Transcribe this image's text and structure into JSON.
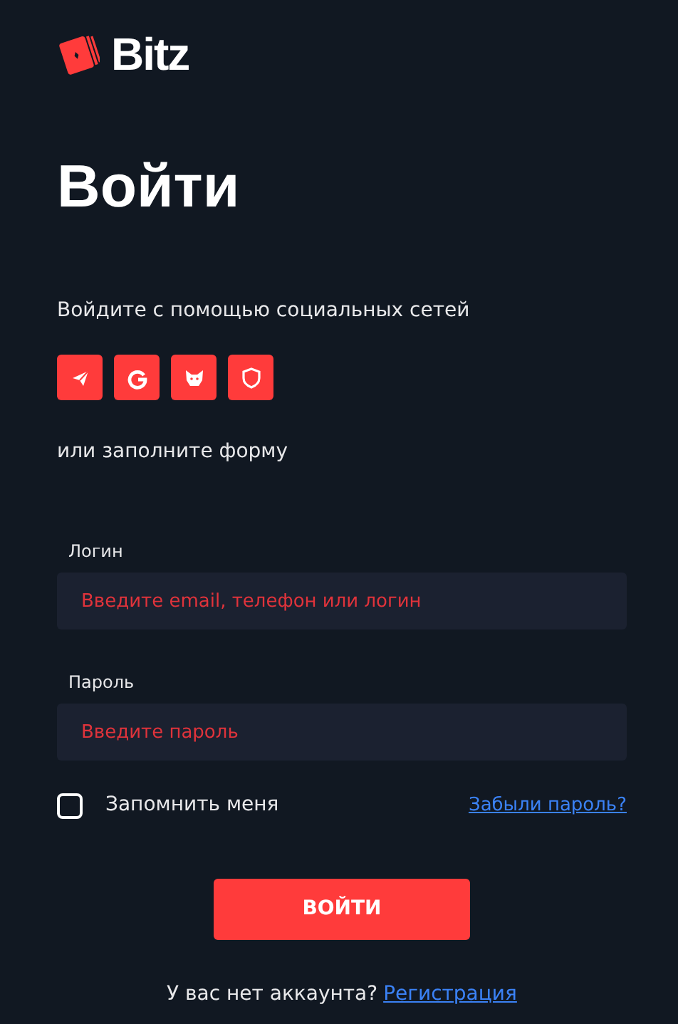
{
  "logo": {
    "text": "Bitz"
  },
  "title": "Войти",
  "social": {
    "caption": "Войдите с помощью социальных сетей",
    "buttons": [
      {
        "kind": "telegram"
      },
      {
        "kind": "google"
      },
      {
        "kind": "fox"
      },
      {
        "kind": "shield"
      }
    ]
  },
  "form_caption": "или заполните форму",
  "fields": [
    {
      "label": "Логин",
      "placeholder": "Введите email, телефон или логин"
    },
    {
      "label": "Пароль",
      "placeholder": "Введите пароль"
    }
  ],
  "remember": {
    "label": "Запомнить меня",
    "checked": false
  },
  "forgot_link": "Забыли пароль?",
  "submit": "ВОЙТИ",
  "footer": {
    "text": "У вас нет аккаунта?",
    "link": "Регистрация"
  }
}
